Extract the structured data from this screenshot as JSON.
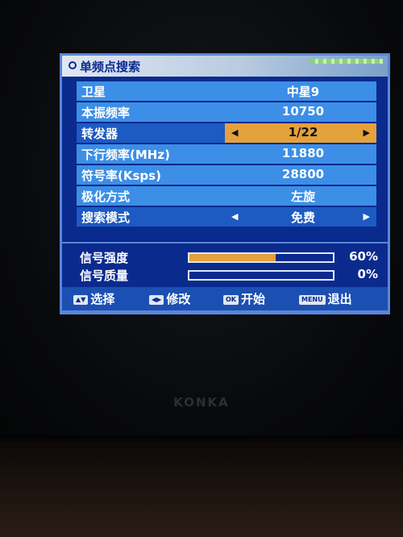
{
  "brand": "KONKA",
  "osd": {
    "title": "单频点搜索",
    "items": [
      {
        "label": "卫星",
        "value": "中星9",
        "arrows": false
      },
      {
        "label": "本振频率",
        "value": "10750",
        "arrows": false
      },
      {
        "label": "转发器",
        "value": "1/22",
        "arrows": true,
        "selected": true
      },
      {
        "label": "下行频率(MHz)",
        "value": "11880",
        "arrows": false
      },
      {
        "label": "符号率(Ksps)",
        "value": "28800",
        "arrows": false
      },
      {
        "label": "极化方式",
        "value": "左旋",
        "arrows": false
      },
      {
        "label": "搜索模式",
        "value": "免费",
        "arrows": true
      }
    ],
    "arrow_left": "◀",
    "arrow_right": "▶"
  },
  "signal": {
    "strength_label": "信号强度",
    "strength_value": "60%",
    "strength_fraction": 0.6,
    "quality_label": "信号质量",
    "quality_value": "0%",
    "quality_fraction": 0.0
  },
  "help": [
    {
      "key": "▲▼",
      "label": "选择"
    },
    {
      "key": "◀▶",
      "label": "修改"
    },
    {
      "key": "OK",
      "label": "开始"
    },
    {
      "key": "MENU",
      "label": "退出"
    }
  ],
  "colors": {
    "osd_background": "#0a2a8e",
    "row_background": "#3c8ee6",
    "selected_value": "#e4a13c",
    "signal_fill": "#e4a13c"
  }
}
